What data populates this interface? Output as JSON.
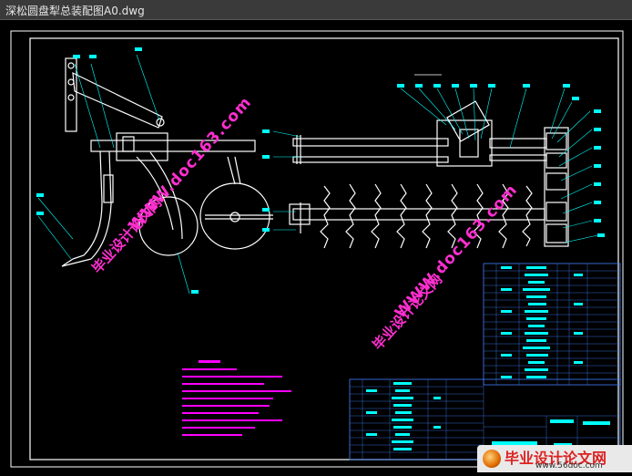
{
  "window": {
    "title": "深松圆盘犁总装配图A0.dwg"
  },
  "watermarks": {
    "site_cn": "毕业设计论文网",
    "site_url": "WWW.doc163.com"
  },
  "corner_logo": {
    "name": "毕业设计论文网",
    "url": "www.56doc.com"
  },
  "colors": {
    "background": "#000000",
    "frame_lines": "#ffffff",
    "drawing_lines": "#ffffff",
    "leader_lines": "#00ffff",
    "table_lines": "#4080ff",
    "table_text": "#00ffff",
    "notes_text": "#ff00ff",
    "watermark": "#ff2fd0"
  }
}
